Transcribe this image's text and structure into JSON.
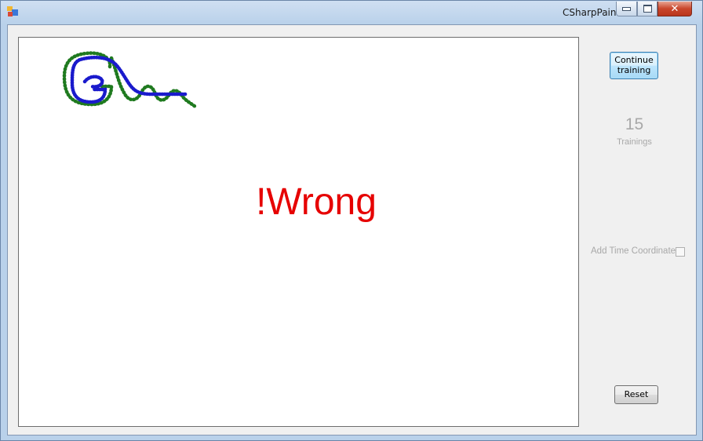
{
  "window": {
    "title": "CSharpPaint",
    "icon": "app-icon",
    "controls": {
      "minimize": "minimize-icon",
      "maximize": "maximize-icon",
      "close": "close-icon"
    }
  },
  "canvas": {
    "result_text": "!Wrong",
    "result_color": "#e60000",
    "stroke_colors": {
      "reference": "#1f7a1f",
      "input": "#1a1acc"
    }
  },
  "side_panel": {
    "continue_button": {
      "line1": "Continue",
      "line2": "training"
    },
    "trainings_count": "15",
    "trainings_label": "Trainings",
    "time_coordinate_label": "Add Time Coordinate",
    "time_coordinate_checked": false,
    "reset_button": "Reset"
  }
}
